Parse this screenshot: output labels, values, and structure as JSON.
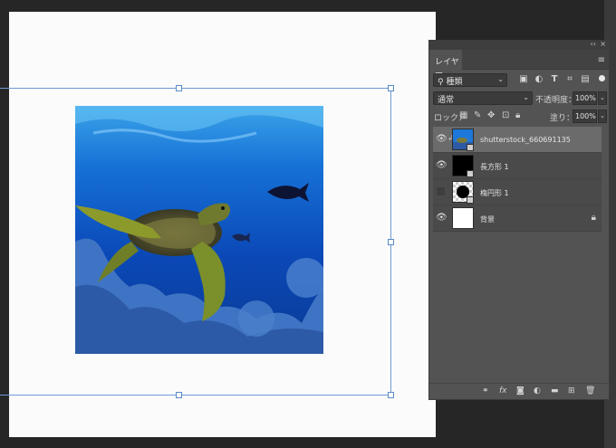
{
  "panel": {
    "collapse": "‹‹",
    "close": "×",
    "tab_label": "レイヤー",
    "menu": "≡"
  },
  "filter": {
    "kind_label": "種類",
    "search_glyph": "⚲",
    "icons": [
      "image-filter-icon",
      "adjustment-filter-icon",
      "type-filter-icon",
      "shape-filter-icon",
      "smartobject-filter-icon"
    ]
  },
  "blend": {
    "mode": "通常",
    "opacity_label": "不透明度：",
    "opacity_value": "100%"
  },
  "lock": {
    "label": "ロック：",
    "fill_label": "塗り：",
    "fill_value": "100%"
  },
  "layers": [
    {
      "name": "shutterstock_660691135",
      "visible": true,
      "thumb": "photo"
    },
    {
      "name": "長方形 1",
      "visible": true,
      "thumb": "rect"
    },
    {
      "name": "楕円形 1",
      "visible": false,
      "thumb": "ellipse"
    },
    {
      "name": "背景",
      "visible": true,
      "thumb": "white",
      "locked": true
    }
  ],
  "bottom": {
    "link": "⚭",
    "fx": "fx"
  },
  "colors": {
    "bounding_box": "#6f9bd4",
    "panel_bg": "#535353",
    "selected_layer": "#6b6b6b"
  }
}
